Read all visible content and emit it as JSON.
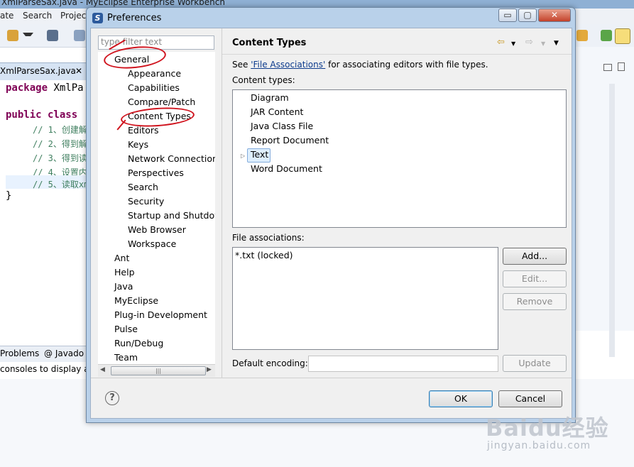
{
  "workbench": {
    "title": "XmlParseSax.java - MyEclipse Enterprise Workbench",
    "menu": [
      "ate",
      "Search",
      "Projec"
    ],
    "editor_tab": "XmlParseSax.java",
    "code": {
      "l1_kw": "package",
      "l1_rest": " XmlPa",
      "l2_kw": "public class",
      "comments": [
        "// 1、创建解",
        "// 2、得到解",
        "// 3、得到读",
        "// 4、设置内",
        "// 5、读取xm"
      ],
      "close": "}"
    },
    "bottom_tabs": {
      "problems": "Problems",
      "javadoc": "@ Javado"
    },
    "console_text": "consoles to display a"
  },
  "dialog": {
    "title": "Preferences",
    "title_controls": {
      "minimize": "▭",
      "maximize": "▢",
      "close": "✕"
    },
    "filter_placeholder": "type filter text",
    "tree": {
      "general": "General",
      "general_children": [
        "Appearance",
        "Capabilities",
        "Compare/Patch",
        "Content Types",
        "Editors",
        "Keys",
        "Network Connections",
        "Perspectives",
        "Search",
        "Security",
        "Startup and Shutdow",
        "Web Browser",
        "Workspace"
      ],
      "top_level": [
        "Ant",
        "Help",
        "Java",
        "MyEclipse",
        "Plug-in Development",
        "Pulse",
        "Run/Debug",
        "Team"
      ]
    },
    "page": {
      "title": "Content Types",
      "desc_prefix": "See ",
      "desc_link": "'File Associations'",
      "desc_suffix": " for associating editors with file types.",
      "content_types_label": "Content types:",
      "content_types": [
        "Diagram",
        "JAR Content",
        "Java Class File",
        "Report Document",
        "Text",
        "Word Document"
      ],
      "selected_type": "Text",
      "file_assoc_label": "File associations:",
      "file_assocs": [
        "*.txt (locked)"
      ],
      "buttons": {
        "add": "Add...",
        "edit": "Edit...",
        "remove": "Remove",
        "update": "Update"
      },
      "encoding_label": "Default encoding:",
      "encoding_value": ""
    },
    "footer": {
      "help": "?",
      "ok": "OK",
      "cancel": "Cancel"
    }
  },
  "watermark": {
    "logo": "Baidu经验",
    "url": "jingyan.baidu.com"
  },
  "colors": {
    "dialog_frame": "#b9d1ea",
    "annotation_red": "#d0141e",
    "link": "#0b3a8c"
  }
}
